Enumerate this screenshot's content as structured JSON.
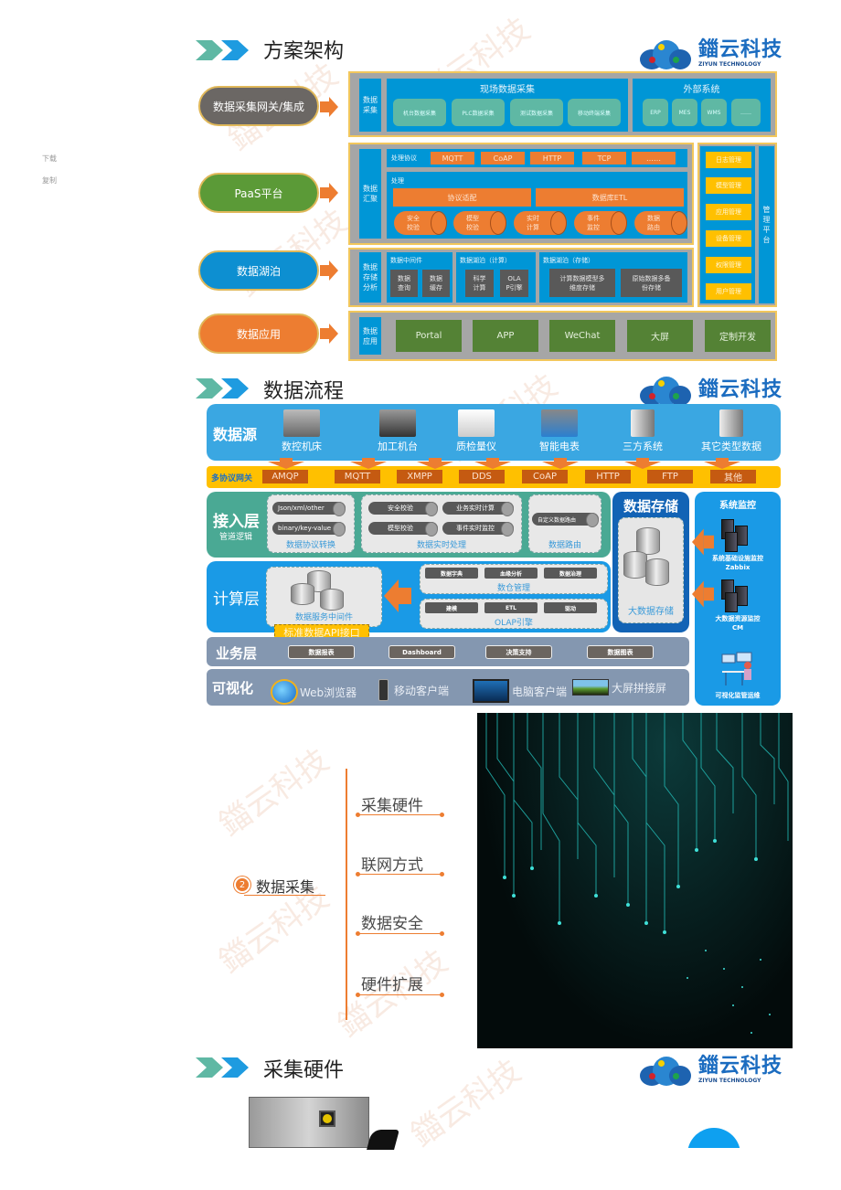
{
  "side_actions": {
    "download": "下载",
    "copy": "复制"
  },
  "logo": {
    "cn": "鍿云科技",
    "en": "ZIYUN TECHNOLOGY"
  },
  "watermark": "鍿云科技",
  "colors": {
    "orange": "#ed7d31",
    "blue": "#0096d6",
    "teal": "#5fb8a4",
    "green": "#548235",
    "yellow": "#ffc000",
    "gray": "#a6a6a6"
  },
  "arch": {
    "title": "方案架构",
    "pills": [
      "数据采集网关/集成",
      "PaaS平台",
      "数据湖泊",
      "数据应用"
    ],
    "collect": {
      "label": "数据\n采集",
      "onsite_title": "现场数据采集",
      "onsite_items": [
        "机台数据采集",
        "PLC数据采集",
        "测试数据采集",
        "移动终端采集"
      ],
      "external_title": "外部系统",
      "external_items": [
        "ERP",
        "MES",
        "WMS",
        "……"
      ]
    },
    "converge": {
      "label": "数据\n汇聚",
      "protocol_title": "处理协议",
      "protocols": [
        "MQTT",
        "CoAP",
        "HTTP",
        "TCP",
        "……"
      ],
      "process_title": "处理",
      "process_bars": [
        "协议适配",
        "数据库ETL"
      ],
      "cylinders": [
        "安全\n校验",
        "模型\n校验",
        "实时\n计算",
        "事件\n监控",
        "数据\n路由"
      ]
    },
    "storage": {
      "label": "数据\n存储\n分析",
      "middleware_title": "数据中间件",
      "middleware_items": [
        "数据\n查询",
        "数据\n缓存"
      ],
      "lake_compute_title": "数据湖泊（计算）",
      "lake_compute_items": [
        "科学\n计算",
        "OLA\nP引擎"
      ],
      "lake_store_title": "数据湖泊（存储）",
      "lake_store_items": [
        "计算数据模型多\n维度存储",
        "原始数据多备\n份存储"
      ]
    },
    "application": {
      "label": "数据\n应用",
      "items": [
        "Portal",
        "APP",
        "WeChat",
        "大屏",
        "定制开发"
      ]
    },
    "management": {
      "label": "管\n理\n平\n台",
      "items": [
        "日志管理",
        "模型管理",
        "应用管理",
        "设备管理",
        "权限管理",
        "用户管理"
      ]
    }
  },
  "flow": {
    "title": "数据流程",
    "source_label": "数据源",
    "sources": [
      "数控机床",
      "加工机台",
      "质检量仪",
      "智能电表",
      "三方系统",
      "其它类型数据"
    ],
    "gateway_label": "多协议网关",
    "protocols": [
      "AMQP",
      "MQTT",
      "XMPP",
      "DDS",
      "CoAP",
      "HTTP",
      "FTP",
      "其他"
    ],
    "access": {
      "label": "接入层",
      "sub": "管道逻辑",
      "convert_items": [
        "Json/xml/other",
        "binary/key-value"
      ],
      "convert_caption": "数据协议转换",
      "realtime_items": [
        "安全校验",
        "业务实时计算",
        "模型校验",
        "事件实时监控"
      ],
      "realtime_caption": "数据实时处理",
      "route_items": [
        "自定义数据路由"
      ],
      "route_caption": "数据路由"
    },
    "storage": {
      "title": "数据存储",
      "caption": "大数据存储"
    },
    "compute": {
      "label": "计算层",
      "middleware_caption": "数据服务中间件",
      "api_label": "标准数据API接口",
      "warehouse_items": [
        "数据字典",
        "血缘分析",
        "数据治理"
      ],
      "warehouse_caption": "数仓管理",
      "olap_items": [
        "建模",
        "ETL",
        "驱动"
      ],
      "olap_caption": "OLAP引擎"
    },
    "business": {
      "label": "业务层",
      "items": [
        "数据报表",
        "Dashboard",
        "决策支持",
        "数据图表"
      ]
    },
    "visual": {
      "label": "可视化",
      "items": [
        "Web浏览器",
        "移动客户端",
        "电脑客户端",
        "大屏拼接屏"
      ]
    },
    "monitor": {
      "title": "系统监控",
      "items": [
        {
          "line1": "系统基础设施监控",
          "line2": "Zabbix"
        },
        {
          "line1": "大数据资源监控",
          "line2": "CM"
        },
        {
          "line1": "可视化监管运维",
          "line2": ""
        }
      ]
    }
  },
  "collection": {
    "number": "2",
    "title": "数据采集",
    "items": [
      "采集硬件",
      "联网方式",
      "数据安全",
      "硬件扩展"
    ]
  },
  "hardware": {
    "title": "采集硬件"
  }
}
